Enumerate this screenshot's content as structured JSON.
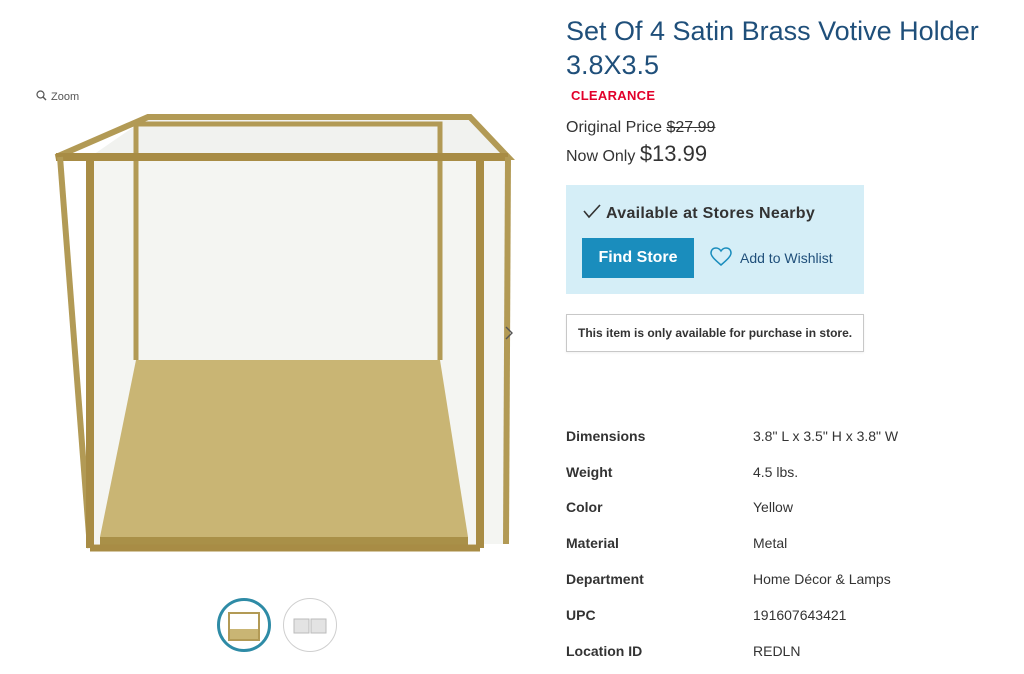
{
  "gallery": {
    "zoom_label": "Zoom",
    "icons": {
      "zoom": "magnifier-icon",
      "prev": "chevron-left-icon",
      "next": "chevron-right-icon"
    }
  },
  "product": {
    "title": "Set Of 4 Satin Brass Votive Holder 3.8X3.5",
    "badge": "CLEARANCE",
    "original_price_label": "Original Price",
    "original_price": "$27.99",
    "now_label": "Now Only",
    "now_price": "$13.99"
  },
  "availability": {
    "text": "Available at Stores Nearby",
    "find_store_label": "Find Store",
    "wishlist_label": "Add to Wishlist",
    "store_note": "This item is only available for purchase in store."
  },
  "specs": [
    {
      "label": "Dimensions",
      "value": "3.8\" L x 3.5\" H x 3.8\" W"
    },
    {
      "label": "Weight",
      "value": "4.5 lbs."
    },
    {
      "label": "Color",
      "value": "Yellow"
    },
    {
      "label": "Material",
      "value": "Metal"
    },
    {
      "label": "Department",
      "value": "Home Décor & Lamps"
    },
    {
      "label": "UPC",
      "value": "191607643421"
    },
    {
      "label": "Location ID",
      "value": "REDLN"
    }
  ],
  "colors": {
    "title": "#1f4f7a",
    "clearance": "#e2002a",
    "availability_bg": "#d5eef7",
    "find_store_button": "#1a8dbd",
    "thumb_active_border": "#2e8ba6",
    "brass": "#b29a55"
  }
}
